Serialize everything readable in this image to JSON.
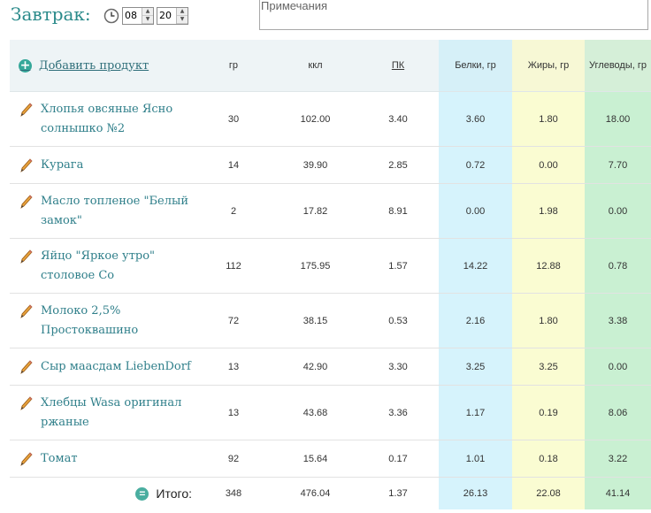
{
  "meal": {
    "title": "Завтрак:"
  },
  "time": {
    "hours": "08",
    "minutes": "20"
  },
  "notes": {
    "placeholder": "Примечания"
  },
  "table": {
    "add_product": "Добавить продукт",
    "headers": {
      "gr": "гр",
      "kcal": "ккл",
      "pk": "ПК",
      "protein": "Белки, гр",
      "fat": "Жиры, гр",
      "carbs": "Углеводы, гр"
    },
    "rows": [
      {
        "name": "Хлопья овсяные Ясно солнышко №2",
        "gr": "30",
        "kcal": "102.00",
        "pk": "3.40",
        "protein": "3.60",
        "fat": "1.80",
        "carbs": "18.00"
      },
      {
        "name": "Курага",
        "gr": "14",
        "kcal": "39.90",
        "pk": "2.85",
        "protein": "0.72",
        "fat": "0.00",
        "carbs": "7.70"
      },
      {
        "name": "Масло топленое \"Белый замок\"",
        "gr": "2",
        "kcal": "17.82",
        "pk": "8.91",
        "protein": "0.00",
        "fat": "1.98",
        "carbs": "0.00"
      },
      {
        "name": "Яйцо \"Яркое утро\" столовое Со",
        "gr": "112",
        "kcal": "175.95",
        "pk": "1.57",
        "protein": "14.22",
        "fat": "12.88",
        "carbs": "0.78"
      },
      {
        "name": "Молоко 2,5% Простоквашино",
        "gr": "72",
        "kcal": "38.15",
        "pk": "0.53",
        "protein": "2.16",
        "fat": "1.80",
        "carbs": "3.38"
      },
      {
        "name": "Сыр маасдам LiebenDorf",
        "gr": "13",
        "kcal": "42.90",
        "pk": "3.30",
        "protein": "3.25",
        "fat": "3.25",
        "carbs": "0.00"
      },
      {
        "name": "Хлебцы Wasa оригинал ржаные",
        "gr": "13",
        "kcal": "43.68",
        "pk": "3.36",
        "protein": "1.17",
        "fat": "0.19",
        "carbs": "8.06"
      },
      {
        "name": "Томат",
        "gr": "92",
        "kcal": "15.64",
        "pk": "0.17",
        "protein": "1.01",
        "fat": "0.18",
        "carbs": "3.22"
      }
    ],
    "total": {
      "label": "Итого:",
      "gr": "348",
      "kcal": "476.04",
      "pk": "1.37",
      "protein": "26.13",
      "fat": "22.08",
      "carbs": "41.14"
    }
  }
}
